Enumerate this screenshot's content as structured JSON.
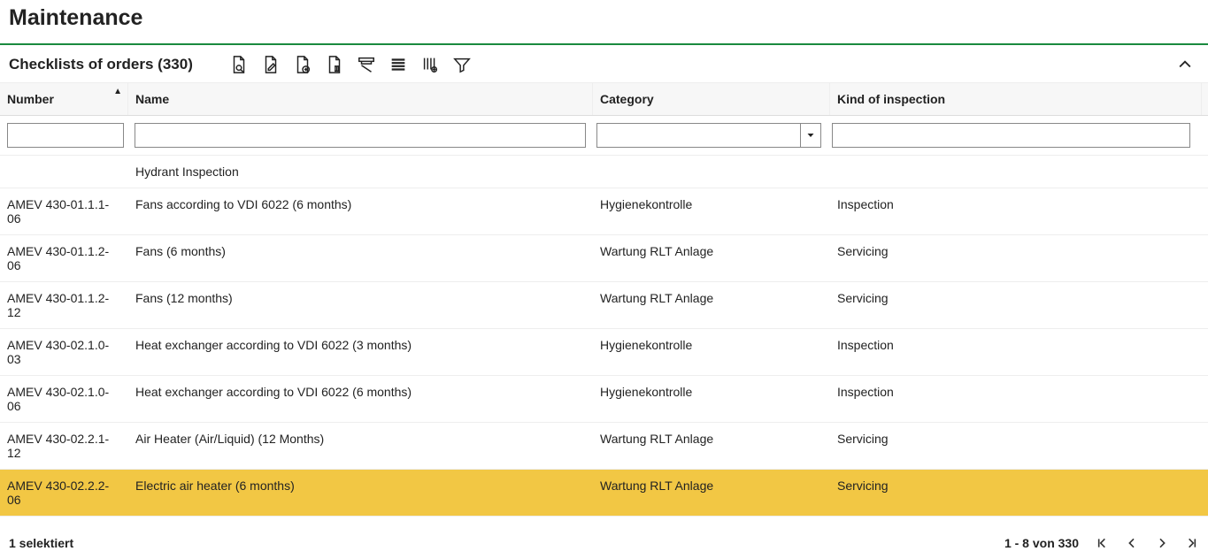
{
  "page": {
    "title": "Maintenance"
  },
  "section": {
    "title": "Checklists of orders (330)"
  },
  "columns": {
    "number": "Number",
    "name": "Name",
    "category": "Category",
    "kind": "Kind of inspection"
  },
  "filters": {
    "number": "",
    "name": "",
    "category": "",
    "kind": ""
  },
  "rows": [
    {
      "number": "",
      "name": "Hydrant Inspection",
      "category": "",
      "kind": ""
    },
    {
      "number": "AMEV 430-01.1.1-06",
      "name": "Fans according to VDI 6022 (6 months)",
      "category": "Hygienekontrolle",
      "kind": "Inspection"
    },
    {
      "number": "AMEV 430-01.1.2-06",
      "name": "Fans (6 months)",
      "category": "Wartung RLT Anlage",
      "kind": "Servicing"
    },
    {
      "number": "AMEV 430-01.1.2-12",
      "name": "Fans (12 months)",
      "category": "Wartung RLT Anlage",
      "kind": "Servicing"
    },
    {
      "number": "AMEV 430-02.1.0-03",
      "name": "Heat exchanger according to VDI 6022 (3 months)",
      "category": "Hygienekontrolle",
      "kind": "Inspection"
    },
    {
      "number": "AMEV 430-02.1.0-06",
      "name": "Heat exchanger according to VDI 6022 (6 months)",
      "category": "Hygienekontrolle",
      "kind": "Inspection"
    },
    {
      "number": "AMEV 430-02.2.1-12",
      "name": "Air Heater (Air/Liquid) (12 Months)",
      "category": "Wartung RLT Anlage",
      "kind": "Servicing"
    },
    {
      "number": "AMEV 430-02.2.2-06",
      "name": "Electric air heater (6 months)",
      "category": "Wartung RLT Anlage",
      "kind": "Servicing"
    }
  ],
  "selected_index": 7,
  "footer": {
    "selection": "1 selektiert",
    "range": "1 - 8 von 330"
  }
}
